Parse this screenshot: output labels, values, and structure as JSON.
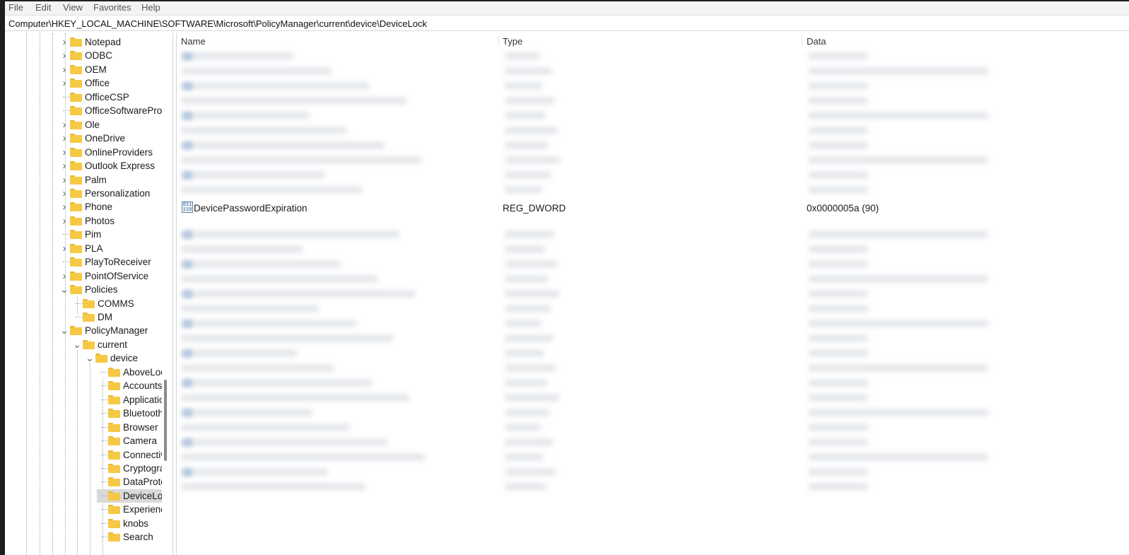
{
  "menu": [
    "File",
    "Edit",
    "View",
    "Favorites",
    "Help"
  ],
  "address": "Computer\\HKEY_LOCAL_MACHINE\\SOFTWARE\\Microsoft\\PolicyManager\\current\\device\\DeviceLock",
  "tree": {
    "items": [
      {
        "label": "Notepad",
        "expander": ">"
      },
      {
        "label": "ODBC",
        "expander": ">"
      },
      {
        "label": "OEM",
        "expander": ">"
      },
      {
        "label": "Office",
        "expander": ">"
      },
      {
        "label": "OfficeCSP",
        "expander": ""
      },
      {
        "label": "OfficeSoftwareProtectionPlatform",
        "expander": ""
      },
      {
        "label": "Ole",
        "expander": ">"
      },
      {
        "label": "OneDrive",
        "expander": ">"
      },
      {
        "label": "OnlineProviders",
        "expander": ">"
      },
      {
        "label": "Outlook Express",
        "expander": ">"
      },
      {
        "label": "Palm",
        "expander": ">"
      },
      {
        "label": "Personalization",
        "expander": ">"
      },
      {
        "label": "Phone",
        "expander": ">"
      },
      {
        "label": "Photos",
        "expander": ">"
      },
      {
        "label": "Pim",
        "expander": ""
      },
      {
        "label": "PLA",
        "expander": ">"
      },
      {
        "label": "PlayToReceiver",
        "expander": ""
      },
      {
        "label": "PointOfService",
        "expander": ">"
      },
      {
        "label": "Policies",
        "expander": "v"
      },
      {
        "label": "COMMS",
        "expander": ""
      },
      {
        "label": "DM",
        "expander": ""
      },
      {
        "label": "PolicyManager",
        "expander": "v"
      },
      {
        "label": "current",
        "expander": "v"
      },
      {
        "label": "device",
        "expander": "v"
      },
      {
        "label": "AboveLock",
        "expander": ""
      },
      {
        "label": "Accounts",
        "expander": ""
      },
      {
        "label": "ApplicationManagement",
        "expander": ""
      },
      {
        "label": "Bluetooth",
        "expander": ""
      },
      {
        "label": "Browser",
        "expander": ""
      },
      {
        "label": "Camera",
        "expander": ""
      },
      {
        "label": "Connectivity",
        "expander": ""
      },
      {
        "label": "Cryptography",
        "expander": ""
      },
      {
        "label": "DataProtection",
        "expander": ""
      },
      {
        "label": "DeviceLock",
        "expander": "",
        "selected": true
      },
      {
        "label": "Experience",
        "expander": ""
      },
      {
        "label": "knobs",
        "expander": ""
      },
      {
        "label": "Search",
        "expander": ""
      }
    ]
  },
  "columns": {
    "name": "Name",
    "type": "Type",
    "data": "Data"
  },
  "focused_value": {
    "icon": "dword-value-icon",
    "name": "DevicePasswordExpiration",
    "type": "REG_DWORD",
    "data": "0x0000005a (90)"
  }
}
